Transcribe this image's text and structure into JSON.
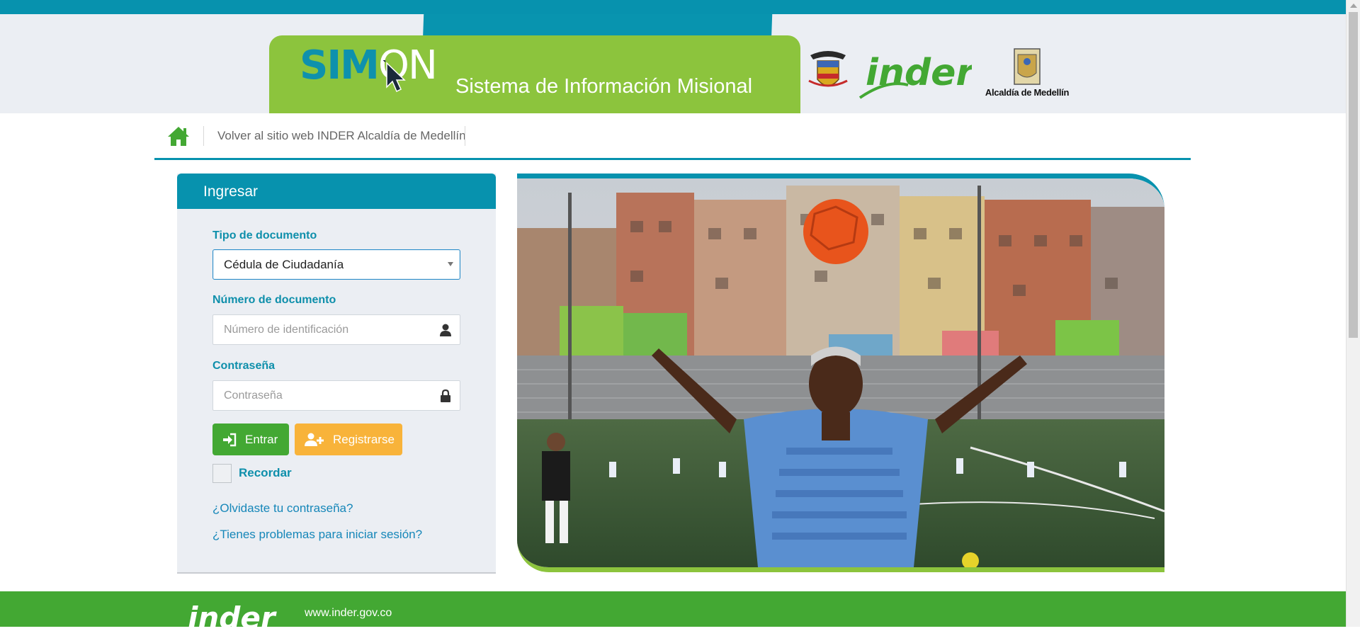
{
  "header": {
    "logo_sim": "SIM",
    "logo_on": "ON",
    "title": "Sistema de Información Misional",
    "inder_logo_text": "inder",
    "alcaldia_text": "Alcaldía de Medellín"
  },
  "nav": {
    "home_icon": "home-icon",
    "back_link": "Volver al sitio web INDER Alcaldía de Medellín"
  },
  "login": {
    "heading": "Ingresar",
    "doc_type_label": "Tipo de documento",
    "doc_type_value": "Cédula de Ciudadanía",
    "doc_number_label": "Número de documento",
    "doc_number_placeholder": "Número de identificación",
    "password_label": "Contraseña",
    "password_placeholder": "Contraseña",
    "enter_button": "Entrar",
    "register_button": "Registrarse",
    "remember_label": "Recordar",
    "forgot_link": "¿Olvidaste tu contraseña?",
    "problems_link": "¿Tienes problemas para iniciar sesión?"
  },
  "footer": {
    "logo_text": "inder",
    "url": "www.inder.gov.co"
  },
  "colors": {
    "primary_teal": "#0792ae",
    "brand_green": "#8cc43d",
    "button_green": "#43a833",
    "button_orange": "#f8b33a"
  }
}
